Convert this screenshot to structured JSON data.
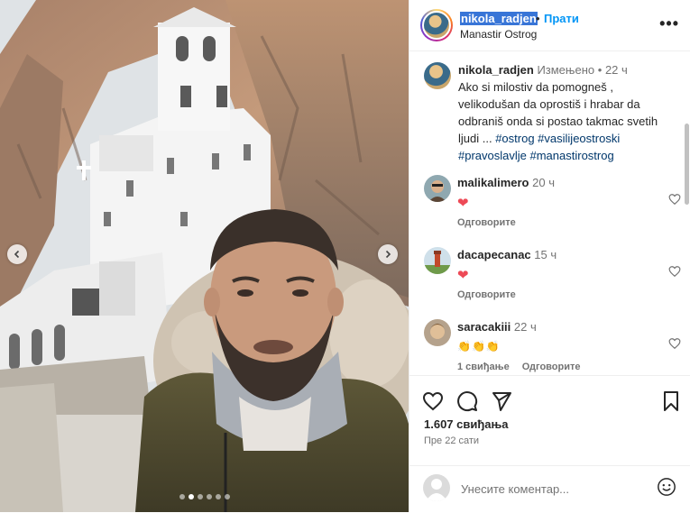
{
  "post": {
    "username": "nikola_radjen",
    "dot": "•",
    "follow_label": "Прати",
    "location": "Manastir Ostrog",
    "more_label": "•••",
    "carousel": {
      "slides": 6,
      "active_index": 1
    }
  },
  "caption": {
    "username": "nikola_radjen",
    "edited": "Измењено",
    "sep": "•",
    "time": "22 ч",
    "text": "Ako si milostiv da pomogneš , velikodušan da oprostiš i hrabar da odbraniš onda si postao takmac svetih ljudi ...",
    "hashtags": "#ostrog #vasilijeostroski #pravoslavlje #manastirostrog"
  },
  "comments": [
    {
      "username": "malikalimero",
      "time": "20 ч",
      "content_icon": "heart-icon",
      "content": "❤",
      "reply_label": "Одговорите",
      "likes_label": ""
    },
    {
      "username": "dacapecanac",
      "time": "15 ч",
      "content_icon": "heart-icon",
      "content": "❤",
      "reply_label": "Одговорите",
      "likes_label": ""
    },
    {
      "username": "saracakiii",
      "time": "22 ч",
      "content_icon": "clap-icon",
      "content": "👏👏👏",
      "reply_label": "Одговорите",
      "likes_label": "1 свиђање"
    }
  ],
  "stats": {
    "likes": "1.607 свиђања",
    "posted": "Пре 22 сати"
  },
  "add_comment": {
    "placeholder": "Унесите коментар..."
  },
  "colors": {
    "accent": "#0095f6",
    "heart": "#ed4956",
    "muted": "#737373",
    "hashtag": "#00376b"
  }
}
